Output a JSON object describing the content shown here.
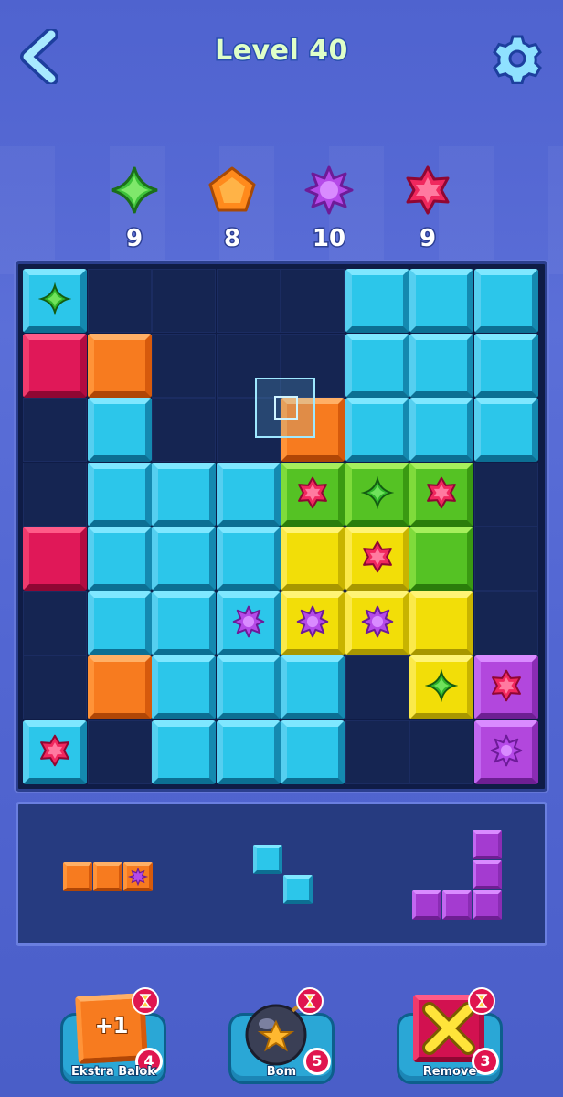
{
  "header": {
    "title": "Level 40"
  },
  "goals": [
    {
      "icon": "green-diamond-gem-icon",
      "count": "9"
    },
    {
      "icon": "orange-pentagon-gem-icon",
      "count": "8"
    },
    {
      "icon": "purple-star-gem-icon",
      "count": "10"
    },
    {
      "icon": "red-star-gem-icon",
      "count": "9"
    }
  ],
  "board": {
    "rows": [
      [
        "cyan:green-gem",
        "empty",
        "empty",
        "empty",
        "empty",
        "cyan",
        "cyan",
        "cyan"
      ],
      [
        "red",
        "orange",
        "empty",
        "empty",
        "empty",
        "cyan",
        "cyan",
        "cyan"
      ],
      [
        "empty",
        "cyan",
        "empty",
        "empty",
        "orange",
        "cyan",
        "cyan",
        "cyan"
      ],
      [
        "empty",
        "cyan",
        "cyan",
        "cyan",
        "green:red-gem",
        "green:green-gem",
        "green:red-gem",
        "empty"
      ],
      [
        "red",
        "cyan",
        "cyan",
        "cyan",
        "yellow",
        "yellow:red-gem",
        "green",
        "empty"
      ],
      [
        "empty",
        "cyan",
        "cyan",
        "cyan:purple-gem",
        "yellow:purple-gem",
        "yellow:purple-gem",
        "yellow",
        "empty"
      ],
      [
        "empty",
        "orange",
        "cyan",
        "cyan",
        "cyan",
        "empty",
        "yellow:green-gem",
        "purple:red-gem"
      ],
      [
        "cyan:red-gem",
        "empty",
        "cyan",
        "cyan",
        "cyan",
        "empty",
        "empty",
        "purple:purple-gem"
      ]
    ]
  },
  "tray": {
    "pieces": [
      {
        "name": "orange-three-bar",
        "color": "orange",
        "cells": 3,
        "gem": "purple-gem"
      },
      {
        "name": "cyan-diagonal-pair",
        "color": "cyan",
        "cells": 2
      },
      {
        "name": "purple-l-piece",
        "color": "purple",
        "cells": 5
      }
    ]
  },
  "boosters": [
    {
      "label": "Ekstra Balok",
      "count": "4",
      "icon_text": "+1",
      "icon": "plus-one-block-icon"
    },
    {
      "label": "Bom",
      "count": "5",
      "icon": "bomb-icon"
    },
    {
      "label": "Remove",
      "count": "3",
      "icon": "remove-x-icon"
    }
  ]
}
